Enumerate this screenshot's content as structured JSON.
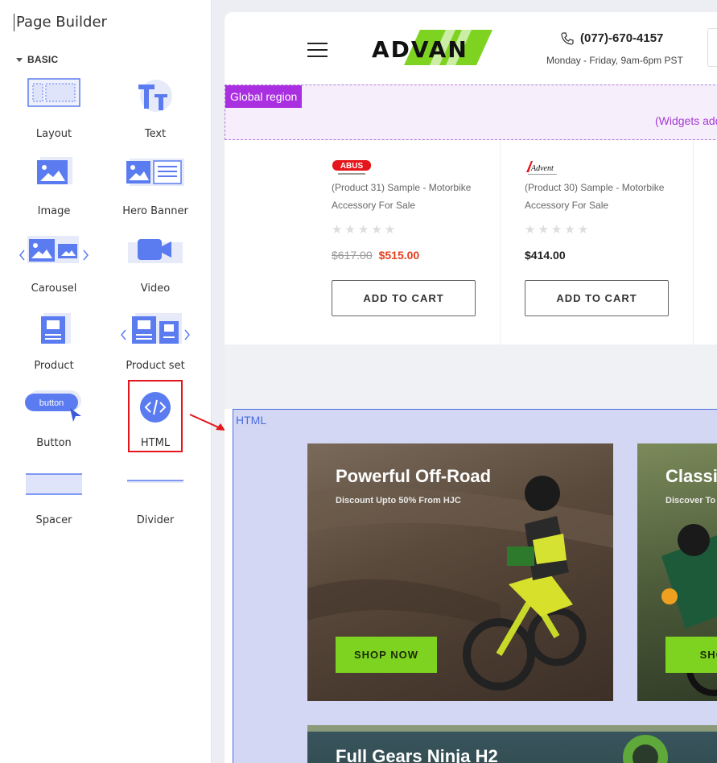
{
  "sidebar": {
    "title": "Page Builder",
    "section": "BASIC",
    "widgets": [
      {
        "label": "Layout"
      },
      {
        "label": "Text"
      },
      {
        "label": "Image"
      },
      {
        "label": "Hero Banner"
      },
      {
        "label": "Carousel"
      },
      {
        "label": "Video"
      },
      {
        "label": "Product"
      },
      {
        "label": "Product set"
      },
      {
        "label": "Button",
        "icon_text": "button"
      },
      {
        "label": "HTML"
      },
      {
        "label": "Spacer"
      },
      {
        "label": "Divider"
      }
    ]
  },
  "header": {
    "logo_text": "ADVAN",
    "phone": "(077)-670-4157",
    "hours": "Monday - Friday, 9am-6pm PST"
  },
  "global_region": {
    "tag": "Global region",
    "hint": "(Widgets add"
  },
  "products": [
    {
      "brand": "ABUS",
      "name": "(Product 31) Sample - Motorbike Accessory For Sale",
      "stars": "★★★★★",
      "old_price": "$617.00",
      "price": "$515.00",
      "button": "ADD TO CART"
    },
    {
      "brand": "Advent",
      "name": "(Product 30) Sample - Motorbike Accessory For Sale",
      "stars": "★★★★★",
      "price": "$414.00",
      "button": "ADD TO CART"
    }
  ],
  "html_region": {
    "tag": "HTML",
    "banners": [
      {
        "title": "Powerful Off-Road",
        "subtitle": "Discount Upto 50% From HJC",
        "button": "SHOP NOW"
      },
      {
        "title": "Classi",
        "subtitle": "Discover To",
        "button": "SHOP"
      },
      {
        "title": "Full Gears Ninja H2"
      }
    ]
  },
  "colors": {
    "accent_green": "#7ed321",
    "global_region": "#a92fe0",
    "html_region_border": "#4a6de0",
    "highlight": "#e4161c",
    "sale_price": "#e4401f"
  }
}
